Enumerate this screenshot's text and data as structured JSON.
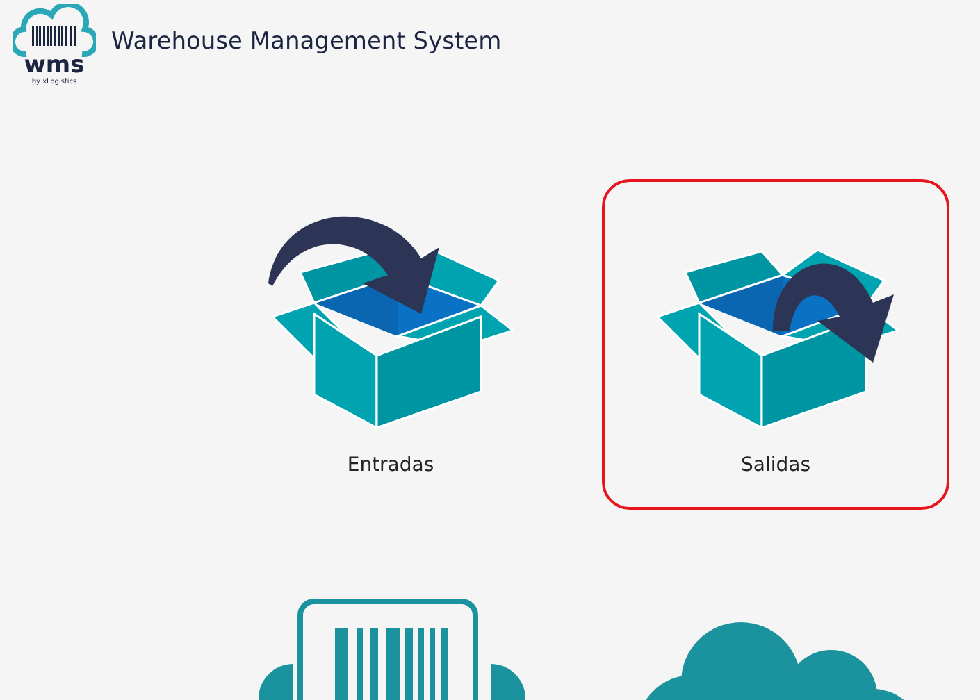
{
  "header": {
    "logo_text": "wms",
    "logo_subtext": "by xLogistics",
    "title": "Warehouse Management System"
  },
  "tiles": [
    {
      "kind": "inbound",
      "label": "Entradas",
      "selected": false
    },
    {
      "kind": "outbound",
      "label": "Salidas",
      "selected": true
    },
    {
      "kind": "scanner",
      "selected": false
    },
    {
      "kind": "cloud",
      "selected": false
    }
  ]
}
